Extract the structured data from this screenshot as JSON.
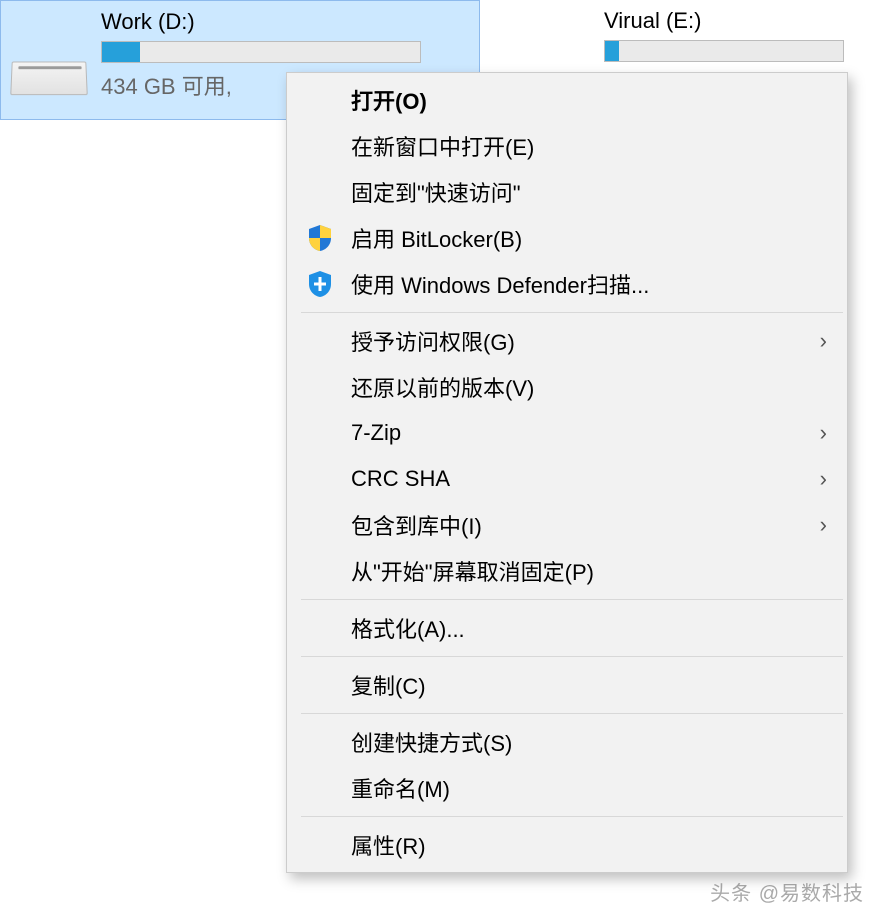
{
  "drives": {
    "d": {
      "label": "Work (D:)",
      "capacity_text": "434 GB 可用,",
      "fill_percent": 12
    },
    "e": {
      "label": "Virual (E:)"
    }
  },
  "menu": {
    "open": "打开(O)",
    "open_new_window": "在新窗口中打开(E)",
    "pin_quick_access": "固定到\"快速访问\"",
    "bitlocker": "启用 BitLocker(B)",
    "defender_scan": "使用 Windows Defender扫描...",
    "give_access": "授予访问权限(G)",
    "restore_versions": "还原以前的版本(V)",
    "seven_zip": "7-Zip",
    "crc_sha": "CRC SHA",
    "include_in_library": "包含到库中(I)",
    "unpin_from_start": "从\"开始\"屏幕取消固定(P)",
    "format": "格式化(A)...",
    "copy": "复制(C)",
    "create_shortcut": "创建快捷方式(S)",
    "rename": "重命名(M)",
    "properties": "属性(R)"
  },
  "watermark": "头条 @易数科技"
}
